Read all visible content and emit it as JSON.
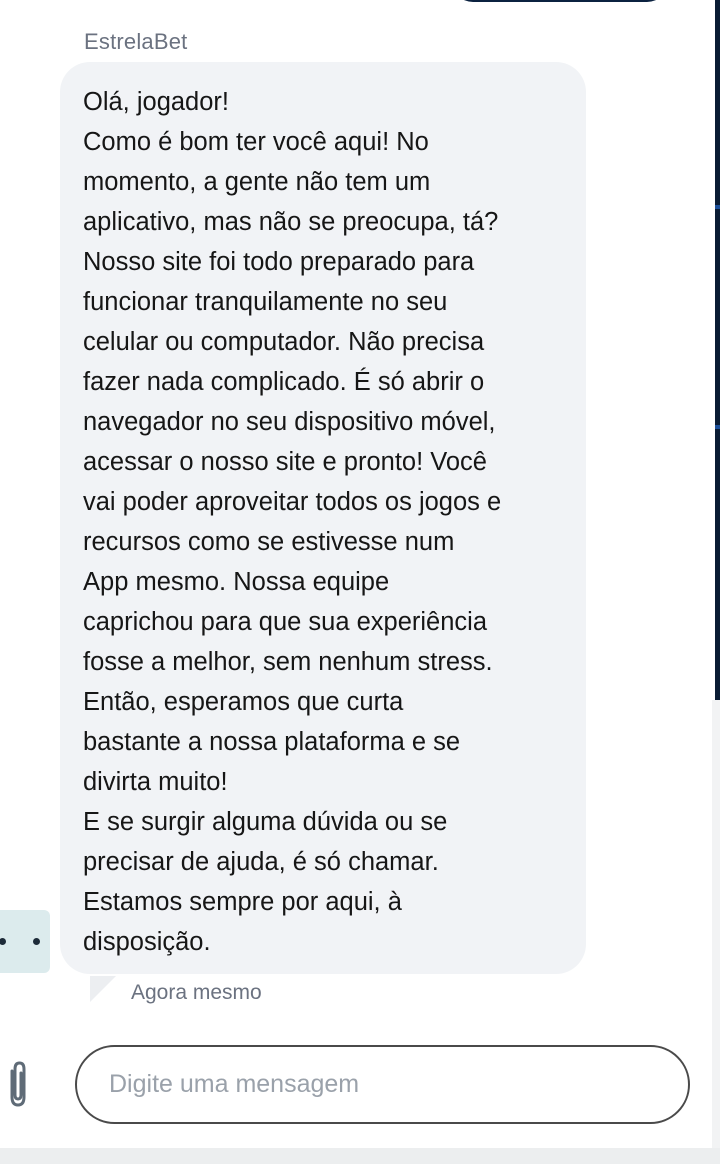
{
  "chat": {
    "sender_name": "EstrelaBet",
    "message": "Olá, jogador!\nComo é bom ter você aqui! No\nmomento, a gente não tem um\naplicativo, mas não se preocupa, tá?\nNosso site foi todo preparado para\nfuncionar tranquilamente no seu\ncelular ou computador. Não precisa\nfazer nada complicado. É só abrir o\nnavegador no seu dispositivo móvel,\nacessar o nosso site e pronto! Você\nvai poder aproveitar todos os jogos e\nrecursos como se estivesse num\nApp mesmo. Nossa equipe\ncaprichou para que sua experiência\nfosse a melhor, sem nenhum stress.\nEntão, esperamos que curta\nbastante a nossa plataforma e se\ndivirta muito!\nE se surgir alguma dúvida ou se\nprecisar de ajuda, é só chamar.\nEstamos sempre por aqui, à\ndisposição.",
    "timestamp": "Agora mesmo"
  },
  "composer": {
    "placeholder": "Digite uma mensagem",
    "value": "",
    "attach_icon": "paperclip-icon"
  },
  "colors": {
    "bubble_background": "#f1f3f6",
    "input_border": "#4a4a4a",
    "typing_indicator_background": "#dcebed",
    "header_button": "#0b2240"
  }
}
